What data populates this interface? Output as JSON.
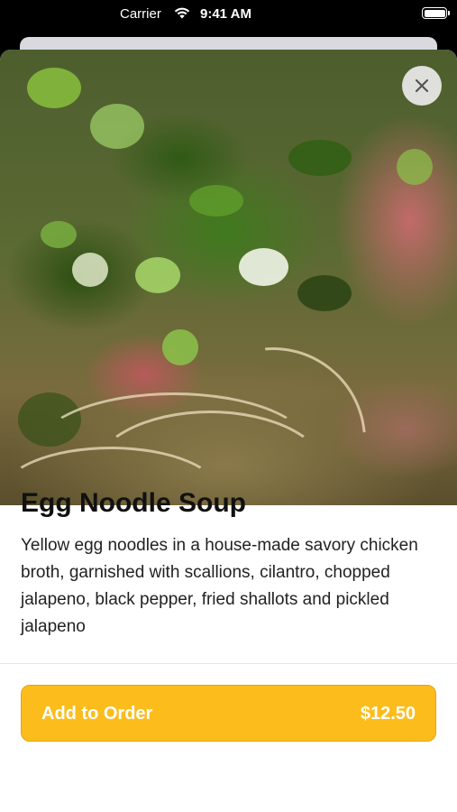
{
  "status_bar": {
    "carrier": "Carrier",
    "time": "9:41 AM",
    "wifi_icon": "wifi-icon",
    "battery_icon": "battery-icon"
  },
  "hero_image": {
    "alt": "Egg Noodle Soup photo"
  },
  "close_icon": "close-icon",
  "item": {
    "title": "Egg Noodle Soup",
    "description": "Yellow egg noodles in a house-made savory chicken broth, garnished with scallions, cilantro, chopped jalapeno, black pepper, fried shallots and pickled jalapeno"
  },
  "order": {
    "add_label": "Add to Order",
    "price": "$12.50",
    "accent_color": "#fcbd1c"
  }
}
